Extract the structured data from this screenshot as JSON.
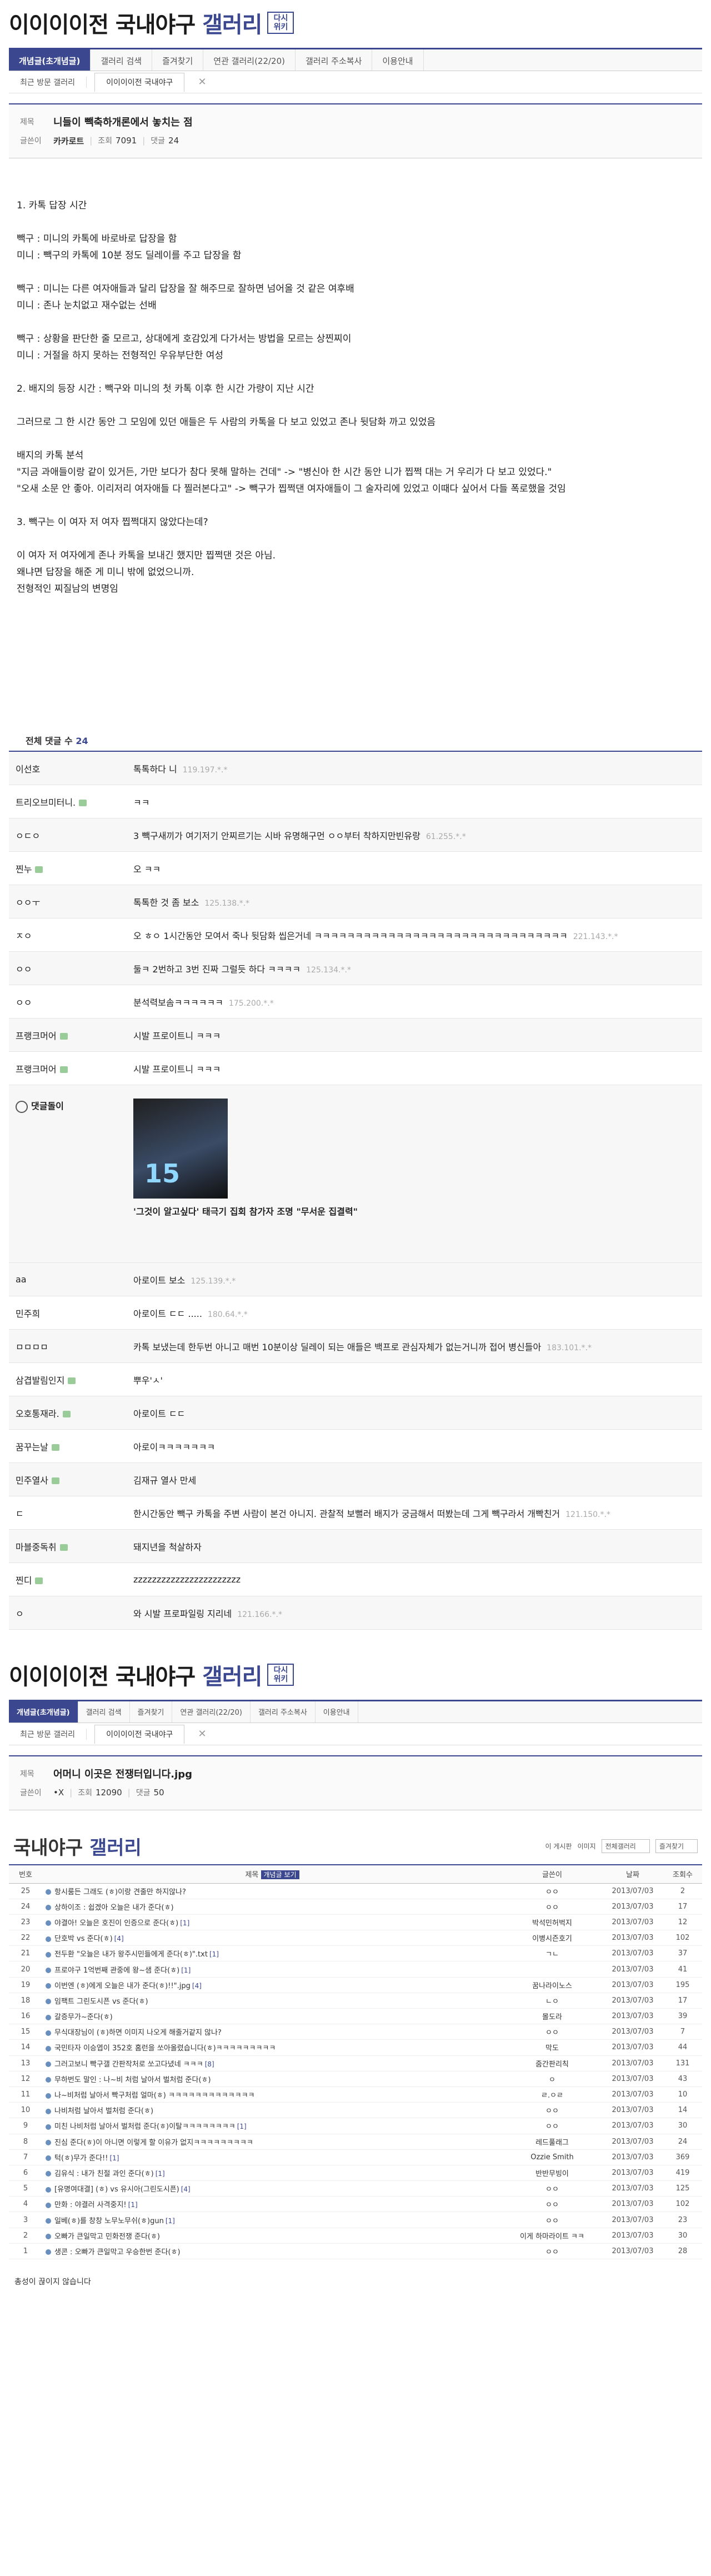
{
  "gallery": {
    "name_a": "이이이이전 국내야구 ",
    "name_b": "갤러리",
    "redo": "다시 위키"
  },
  "tabs": [
    "개념글(초개념글)",
    "갤러리 검색",
    "즐겨찾기",
    "연관 갤러리(22/20)",
    "갤러리 주소복사",
    "이용안내"
  ],
  "recent": {
    "label": "최근 방문 갤러리",
    "tab": "이이이이전 국내야구",
    "close": "✕"
  },
  "post": {
    "title_key": "제목",
    "title": "니들이 빽축하개론에서 놓치는 점",
    "author_key": "글쓴이",
    "author": "카카로트",
    "views_key": "조회",
    "views": "7091",
    "comments_key": "댓글",
    "comments": "24"
  },
  "body": [
    "",
    "1. 카톡 답장 시간",
    "",
    "빽구 : 미니의 카톡에 바로바로 답장을 함",
    "미니 : 빽구의 카톡에 10분 정도 딜레이를 주고 답장을 함",
    "",
    "빽구 : 미니는 다른 여자애들과 달리 답장을 잘 해주므로 잘하면 넘어올 것 같은 여후배",
    "미니 : 존나 눈치없고 재수없는 선배",
    "",
    "빽구 : 상황을 판단한 줄 모르고, 상대에게 호감있게 다가서는 방법을 모르는 상찐찌이",
    "미니 : 거절을 하지 못하는 전형적인 우유부단한 여성",
    "",
    "2. 배지의 등장 시간 : 빽구와 미니의 첫 카톡 이후 한 시간 가량이 지난 시간",
    "",
    "그러므로 그 한 시간 동안 그 모임에 있던 애들은 두 사람의 카톡을 다 보고 있었고 존나 뒷담화 까고 있었음",
    "",
    "배지의 카톡 분석",
    "\"지금 과애들이랑 같이 있거든, 가만 보다가 참다 못해 말하는 건데\" -> \"병신아 한 시간 동안 니가 찝쩍 대는 거 우리가 다 보고 있었다.\"",
    "\"오새 소문 안 좋아. 이리저리 여자애들 다 찔러본다고\" -> 빽구가 찝쩍댄 여자애들이 그 술자리에 있었고 이때다 싶어서 다들 폭로했을 것임",
    "",
    "3. 빽구는 이 여자 저 여자 찝쩍대지 않았다는데?",
    "",
    "이 여자 저 여자에게 존나 카톡을 보내긴 했지만 찝쩍댄 것은 아님.",
    "왜냐면 답장을 해준 게 미니 밖에 없었으니까.",
    "전형적인 찌질남의 변명임"
  ],
  "comments_head": {
    "label": "전체 댓글 수",
    "count": "24"
  },
  "comments": [
    {
      "nick": "이선호",
      "text": "톡톡하다 니",
      "ip": "119.197.*.*",
      "lvl": false
    },
    {
      "nick": "트리오브미터니.",
      "text": "ㅋㅋ",
      "ip": "",
      "lvl": true
    },
    {
      "nick": "ㅇㄷㅇ",
      "text": "3 빽구새끼가 여기저기 안찌르기는 시바 유명해구먼 ㅇㅇ부터 착하지만빈유랑",
      "ip": "61.255.*.*",
      "lvl": false
    },
    {
      "nick": "찐누",
      "text": "오 ㅋㅋ",
      "ip": "",
      "lvl": true
    },
    {
      "nick": "ㅇㅇㅜ",
      "text": "톡톡한 것 좀 보소",
      "ip": "125.138.*.*",
      "lvl": false
    },
    {
      "nick": "ㅈㅇ",
      "text": "오 ㅎㅇ 1시간동안 모여서 죽나 뒷담화 씹은거네 ㅋㅋㅋㅋㅋㅋㅋㅋㅋㅋㅋㅋㅋㅋㅋㅋㅋㅋㅋㅋㅋㅋㅋㅋㅋㅋㅋㅋㅋㅋㅋ",
      "ip": "221.143.*.*",
      "lvl": false
    },
    {
      "nick": "ㅇㅇ",
      "text": "둘ㅋ 2번하고 3번 진짜 그럴듯 하다 ㅋㅋㅋㅋ",
      "ip": "125.134.*.*",
      "lvl": false
    },
    {
      "nick": "ㅇㅇ",
      "text": "분석력보솜ㅋㅋㅋㅋㅋㅋ",
      "ip": "175.200.*.*",
      "lvl": false
    },
    {
      "nick": "프랭크머어",
      "text": "시발 프로이트니 ㅋㅋㅋ",
      "ip": "",
      "lvl": true
    },
    {
      "nick": "프랭크머어",
      "text": "시발 프로이트니 ㅋㅋㅋ",
      "ip": "",
      "lvl": true
    }
  ],
  "image_comment": {
    "nick": "댓글돌이",
    "badge": "15",
    "caption": "'그것이 알고싶다' 태극기 집회 참가자 조명 \"무서운 집결력\""
  },
  "comments2": [
    {
      "nick": "aa",
      "text": "아로이트 보소",
      "ip": "125.139.*.*",
      "lvl": false
    },
    {
      "nick": "민주희",
      "text": "아로이트 ㄷㄷ .....",
      "ip": "180.64.*.*",
      "lvl": false
    },
    {
      "nick": "ㅁㅁㅁㅁ",
      "text": "카톡 보냈는데 한두번 아니고 매번 10분이상 딜레이 되는 애들은 백프로 관심자체가 없는거니까 접어 병신들아",
      "ip": "183.101.*.*",
      "lvl": false
    },
    {
      "nick": "삼겹발림인지",
      "text": "뿌우'ㅅ'",
      "ip": "",
      "lvl": true
    },
    {
      "nick": "오호통재라.",
      "text": "아로이트 ㄷㄷ",
      "ip": "",
      "lvl": true
    },
    {
      "nick": "꿈꾸는날",
      "text": "아로이ㅋㅋㅋㅋㅋㅋㅋ",
      "ip": "",
      "lvl": true
    },
    {
      "nick": "민주열사",
      "text": "김재규 열사 만세",
      "ip": "",
      "lvl": true
    },
    {
      "nick": "ㄷ",
      "text": "한시간동안 빽구 카톡을 주변 사람이 본건 아니지. 관찰적 보뻘러 배지가 궁금해서 떠봤는데 그게 빽구라서 개빡친거",
      "ip": "121.150.*.*",
      "lvl": false
    },
    {
      "nick": "마블중독취",
      "text": "돼지년을 척살하자",
      "ip": "",
      "lvl": true
    },
    {
      "nick": "찐디",
      "text": "zzzzzzzzzzzzzzzzzzzzzzz",
      "ip": "",
      "lvl": true
    },
    {
      "nick": "ㅇ",
      "text": "와 시발 프로파일링 지리네",
      "ip": "121.166.*.*",
      "lvl": false
    }
  ],
  "sec2": {
    "post_title": "어머니 이곳은 전쟁터입니다.jpg",
    "author": "•X",
    "views": "12090",
    "comments": "50"
  },
  "list": {
    "title_a": "국내야구 ",
    "title_b": "갤러리",
    "tool1": "이 게시판",
    "tool2": "이미지",
    "select1": "전체갤러리",
    "select2": "즐겨찾기",
    "col_num": "번호",
    "col_title": "제목",
    "col_concept": "개념글 보기",
    "col_author": "글쓴이",
    "col_date": "날짜",
    "col_hit": "조회수"
  },
  "rows": [
    {
      "n": "25",
      "t": "항시룸든 그래도 (ㅎ)이랑 견줄만 하지않나?",
      "c": "",
      "a": "ㅇㅇ",
      "d": "2013/07/03",
      "h": "2"
    },
    {
      "n": "24",
      "t": "상하이조 : 쉽겠아 오늘은 내가 준다(ㅎ)",
      "c": "",
      "a": "ㅇㅇ",
      "d": "2013/07/03",
      "h": "17"
    },
    {
      "n": "23",
      "t": "야결아! 오늘은 호진이 인증으로 준다(ㅎ)",
      "c": "[1]",
      "a": "박석민허벅지",
      "d": "2013/07/03",
      "h": "12"
    },
    {
      "n": "22",
      "t": "단호박 vs 준다(ㅎ)",
      "c": "[4]",
      "a": "이병시즌호기",
      "d": "2013/07/03",
      "h": "102"
    },
    {
      "n": "21",
      "t": "전두환 \"오늘은 내가 왕주시민들에게 준다(ㅎ)\".txt",
      "c": "[1]",
      "a": "ㄱㄴ",
      "d": "2013/07/03",
      "h": "37"
    },
    {
      "n": "20",
      "t": "프로야구 1억번째 관중에 왕~샘 준다(ㅎ)",
      "c": "[1]",
      "a": "",
      "d": "2013/07/03",
      "h": "41"
    },
    {
      "n": "19",
      "t": "이번엔 (ㅎ)에게 오늘은 내가 준다(ㅎ)!!\".jpg",
      "c": "[4]",
      "a": "꿈나라이노스",
      "d": "2013/07/03",
      "h": "195"
    },
    {
      "n": "18",
      "t": "임팩트 그린도시픈 vs 준다(ㅎ)",
      "c": "",
      "a": "ㄴㅇ",
      "d": "2013/07/03",
      "h": "17"
    },
    {
      "n": "16",
      "t": "갈증무가~준다(ㅎ)",
      "c": "",
      "a": "몰도라",
      "d": "2013/07/03",
      "h": "39"
    },
    {
      "n": "15",
      "t": "무식대장님이 (ㅎ)하면 이미지 나오게 해줄거같지 않나?",
      "c": "",
      "a": "ㅇㅇ",
      "d": "2013/07/03",
      "h": "7"
    },
    {
      "n": "14",
      "t": "국민타자 이승엽이 352호 홈런을 쏘아올렸습니다(ㅎ)ㅋㅋㅋㅋㅋㅋㅋㅋㅋ",
      "c": "",
      "a": "막도",
      "d": "2013/07/03",
      "h": "44"
    },
    {
      "n": "13",
      "t": "그러고보니 빡구갤 간판작처로 쏘고다녔네 ㅋㅋㅋ",
      "c": "[8]",
      "a": "줌간판리칙",
      "d": "2013/07/03",
      "h": "131"
    },
    {
      "n": "12",
      "t": "무하번도 말인 : 나~비 처럼 날아서 벌처럼 준다(ㅎ)",
      "c": "",
      "a": "ㅇ",
      "d": "2013/07/03",
      "h": "43"
    },
    {
      "n": "11",
      "t": "나~비처럼 날아서 빡구처럼 얼마(ㅎ) ㅋㅋㅋㅋㅋㅋㅋㅋㅋㅋㅋㅋㅋ",
      "c": "",
      "a": "ㄹ.ㅇㄹ",
      "d": "2013/07/03",
      "h": "10"
    },
    {
      "n": "10",
      "t": "나비처럼 날아서 벌처럼 준다(ㅎ)",
      "c": "",
      "a": "ㅇㅇ",
      "d": "2013/07/03",
      "h": "14"
    },
    {
      "n": "9",
      "t": "미친 나비처럼 날아서 벌처럼 준다(ㅎ)이탈ㅋㅋㅋㅋㅋㅋㅋㅋ",
      "c": "[1]",
      "a": "ㅇㅇ",
      "d": "2013/07/03",
      "h": "30"
    },
    {
      "n": "8",
      "t": "진심 준다(ㅎ)이 아니면 이렇게 할 이유가 없지ㅋㅋㅋㅋㅋㅋㅋㅋㅋ",
      "c": "",
      "a": "레드풀래그",
      "d": "2013/07/03",
      "h": "24"
    },
    {
      "n": "7",
      "t": "턱(ㅎ)무가 준다!!",
      "c": "[1]",
      "a": "Ozzie Smith",
      "d": "2013/07/03",
      "h": "369"
    },
    {
      "n": "6",
      "t": "김유식 : 내가 친절 과인 준다(ㅎ)",
      "c": "[1]",
      "a": "반반무빙이",
      "d": "2013/07/03",
      "h": "419"
    },
    {
      "n": "5",
      "t": "[유명여대결] (ㅎ) vs 유시아(그린도시픈)",
      "c": "[4]",
      "a": "ㅇㅇ",
      "d": "2013/07/03",
      "h": "125"
    },
    {
      "n": "4",
      "t": "만화 : 야결러 사격중지!",
      "c": "[1]",
      "a": "ㅇㅇ",
      "d": "2013/07/03",
      "h": "102"
    },
    {
      "n": "3",
      "t": "일베(ㅎ)를 창창 노무노무쉬(ㅎ)gun",
      "c": "[1]",
      "a": "ㅇㅇ",
      "d": "2013/07/03",
      "h": "23"
    },
    {
      "n": "2",
      "t": "오빠가 큰일막고 민화전쟁 준다(ㅎ)",
      "c": "",
      "a": "이게 하마라이트 ㅋㅋ",
      "d": "2013/07/03",
      "h": "30"
    },
    {
      "n": "1",
      "t": "생콘 : 오빠가 큰일막고 우승한번 준다(ㅎ)",
      "c": "",
      "a": "ㅇㅇ",
      "d": "2013/07/03",
      "h": "28"
    }
  ],
  "footer": "총성이 끊이지 않습니다"
}
